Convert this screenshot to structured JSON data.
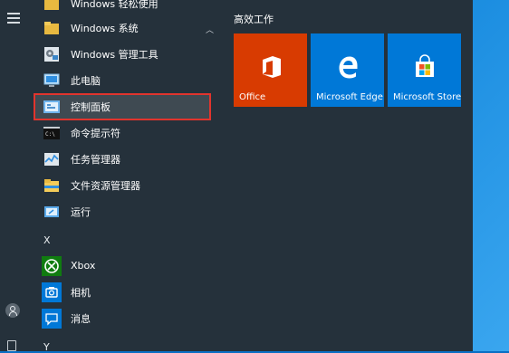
{
  "apps": {
    "top_partial": "Windows 轻松使用",
    "folder": "Windows 系统",
    "items": [
      {
        "label": "Windows 管理工具"
      },
      {
        "label": "此电脑"
      },
      {
        "label": "控制面板"
      },
      {
        "label": "命令提示符"
      },
      {
        "label": "任务管理器"
      },
      {
        "label": "文件资源管理器"
      },
      {
        "label": "运行"
      }
    ],
    "letter_x": "X",
    "x_items": [
      {
        "label": "Xbox"
      },
      {
        "label": "相机"
      },
      {
        "label": "消息"
      }
    ],
    "letter_y": "Y"
  },
  "tiles": {
    "section_title": "高效工作",
    "items": [
      {
        "label": "Office",
        "color": "#d83b01"
      },
      {
        "label": "Microsoft Edge",
        "color": "#0078d7"
      },
      {
        "label": "Microsoft Store",
        "color": "#0078d7"
      }
    ]
  },
  "icons": {
    "hamburger": "hamburger-menu-icon",
    "user": "user-account-icon",
    "document": "documents-icon"
  },
  "colors": {
    "start_bg": "#25313b",
    "highlight_border": "#e2342d"
  }
}
